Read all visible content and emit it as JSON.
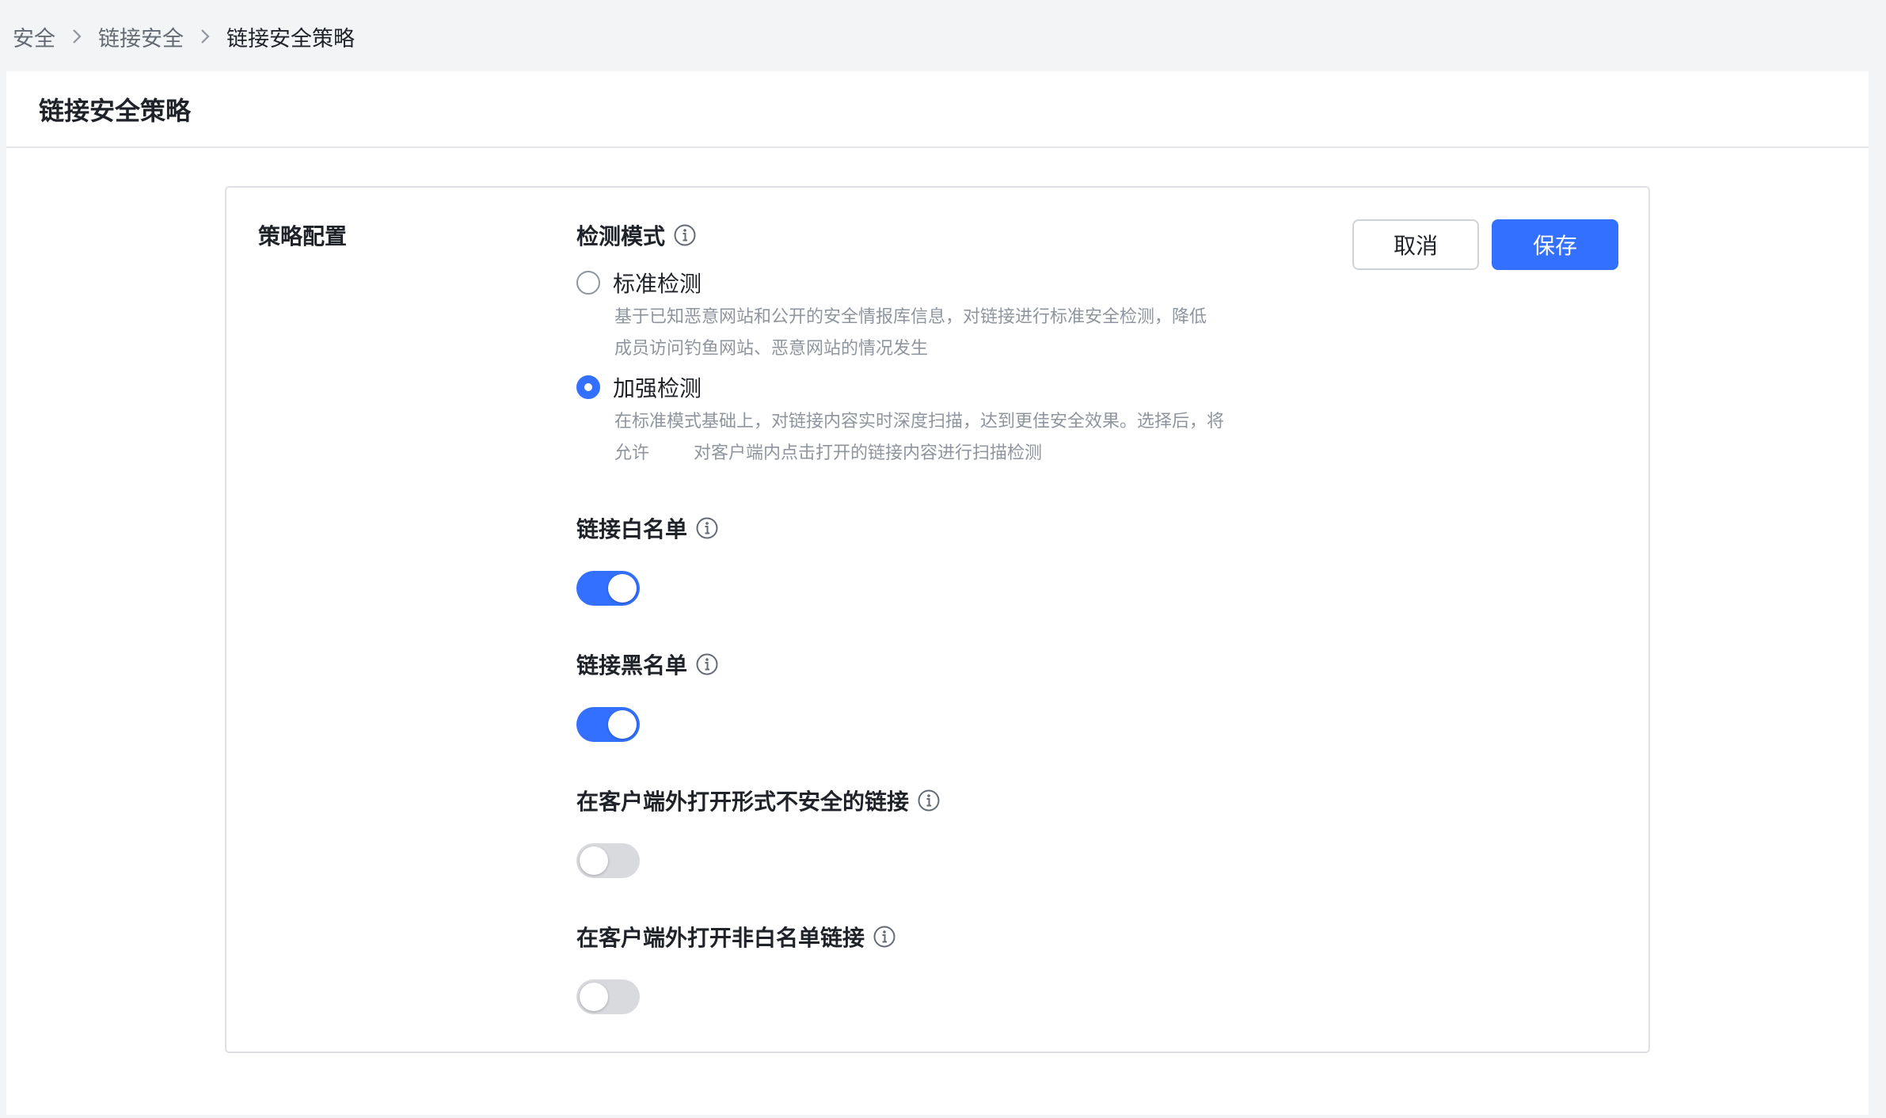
{
  "breadcrumb": {
    "items": [
      "安全",
      "链接安全",
      "链接安全策略"
    ]
  },
  "page": {
    "title": "链接安全策略"
  },
  "card": {
    "section_title": "策略配置",
    "cancel_label": "取消",
    "save_label": "保存",
    "detection_mode": {
      "label": "检测模式",
      "options": [
        {
          "label": "标准检测",
          "checked": false,
          "description_lines": [
            "基于已知恶意网站和公开的安全情报库信息，对链接进行标准安全检测，降低",
            "成员访问钓鱼网站、恶意网站的情况发生"
          ]
        },
        {
          "label": "加强检测",
          "checked": true,
          "description_lines": [
            "在标准模式基础上，对链接内容实时深度扫描，达到更佳安全效果。选择后，将",
            "允许        对客户端内点击打开的链接内容进行扫描检测"
          ]
        }
      ]
    },
    "settings": [
      {
        "label": "链接白名单",
        "enabled": true
      },
      {
        "label": "链接黑名单",
        "enabled": true
      },
      {
        "label": "在客户端外打开形式不安全的链接",
        "enabled": false
      },
      {
        "label": "在客户端外打开非白名单链接",
        "enabled": false
      }
    ]
  },
  "colors": {
    "primary": "#3370ff",
    "toggle_off": "#d8dadd",
    "background": "#f3f4f6",
    "muted_text": "#8f959e"
  },
  "icons": {
    "breadcrumb_separator": "chevron-right-icon",
    "info": "info-circle-icon"
  }
}
